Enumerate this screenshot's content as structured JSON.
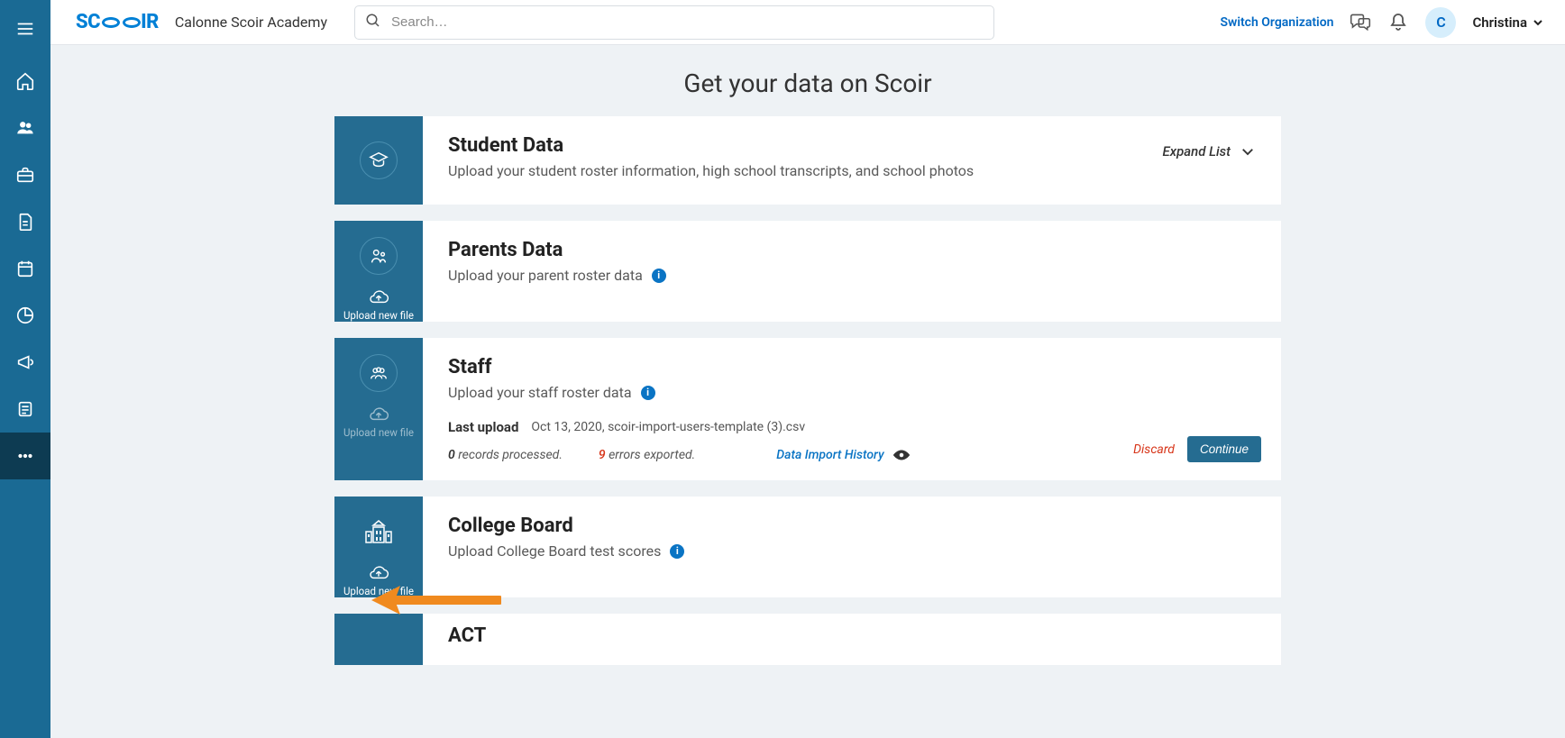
{
  "brand": "SCOIR",
  "org_name": "Calonne Scoir Academy",
  "search_placeholder": "Search…",
  "switch_org": "Switch Organization",
  "user": {
    "initial": "C",
    "name": "Christina"
  },
  "page_title": "Get your data on Scoir",
  "expand_list": "Expand List",
  "upload_new_file": "Upload new file",
  "cards": {
    "student": {
      "title": "Student Data",
      "desc": "Upload your student roster information, high school transcripts, and school photos"
    },
    "parents": {
      "title": "Parents Data",
      "desc": "Upload your parent roster data"
    },
    "staff": {
      "title": "Staff",
      "desc": "Upload your staff roster data",
      "last_upload_label": "Last upload",
      "last_upload_value": "Oct 13, 2020, scoir-import-users-template (3).csv",
      "processed_n": "0",
      "processed_txt": " records processed.",
      "errors_n": "9",
      "errors_txt": " errors exported.",
      "history": "Data Import History",
      "discard": "Discard",
      "continue": "Continue"
    },
    "collegeboard": {
      "title": "College Board",
      "desc": "Upload College Board test scores"
    },
    "act": {
      "title": "ACT"
    }
  }
}
